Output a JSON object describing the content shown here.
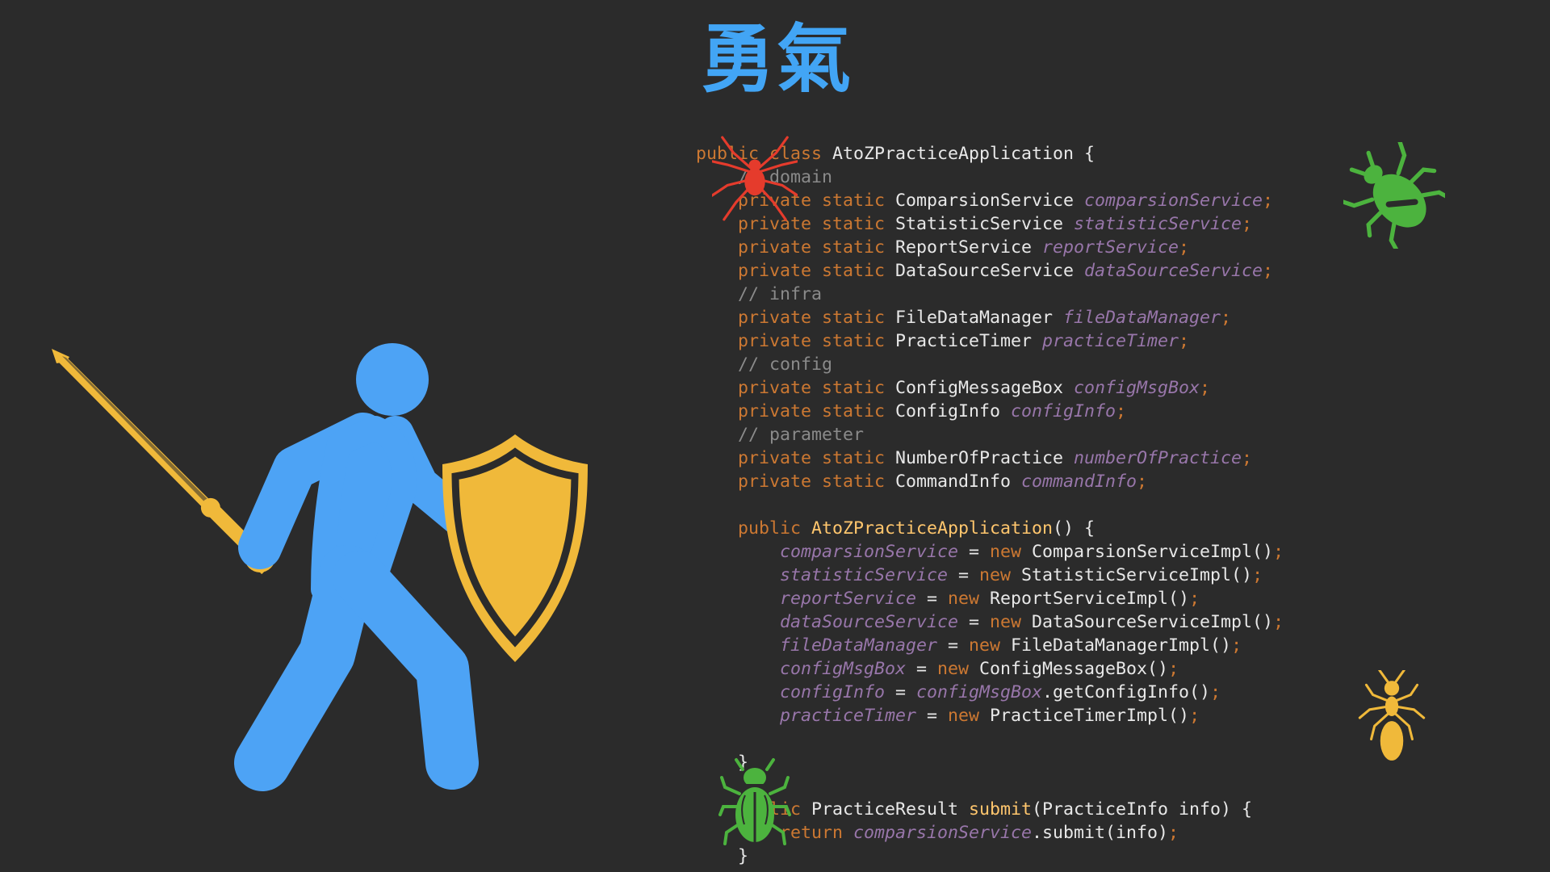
{
  "title": "勇氣",
  "icons": {
    "hero": "knight-with-sword-and-shield-icon",
    "bugs": [
      "spider-icon",
      "beetle-icon",
      "ant-icon",
      "scarab-beetle-icon"
    ]
  },
  "colors": {
    "background": "#2b2b2b",
    "title": "#42a5f5",
    "hero": "#4da3f5",
    "gold": "#f0b93a",
    "spider": "#e53b2c",
    "beetle": "#4cb33e",
    "ant": "#f0b93a"
  },
  "code_lines": [
    [
      {
        "t": "public ",
        "c": "kw"
      },
      {
        "t": "class ",
        "c": "kw"
      },
      {
        "t": "AtoZPracticeApplication ",
        "c": "cls"
      },
      {
        "t": "{",
        "c": "cls"
      }
    ],
    [
      {
        "t": "    // domain",
        "c": "cm"
      }
    ],
    [
      {
        "t": "    private static ",
        "c": "kw"
      },
      {
        "t": "ComparsionService ",
        "c": "cls"
      },
      {
        "t": "comparsionService",
        "c": "fld"
      },
      {
        "t": ";",
        "c": "punc"
      }
    ],
    [
      {
        "t": "    private static ",
        "c": "kw"
      },
      {
        "t": "StatisticService ",
        "c": "cls"
      },
      {
        "t": "statisticService",
        "c": "fld"
      },
      {
        "t": ";",
        "c": "punc"
      }
    ],
    [
      {
        "t": "    private static ",
        "c": "kw"
      },
      {
        "t": "ReportService ",
        "c": "cls"
      },
      {
        "t": "reportService",
        "c": "fld"
      },
      {
        "t": ";",
        "c": "punc"
      }
    ],
    [
      {
        "t": "    private static ",
        "c": "kw"
      },
      {
        "t": "DataSourceService ",
        "c": "cls"
      },
      {
        "t": "dataSourceService",
        "c": "fld"
      },
      {
        "t": ";",
        "c": "punc"
      }
    ],
    [
      {
        "t": "    // infra",
        "c": "cm"
      }
    ],
    [
      {
        "t": "    private static ",
        "c": "kw"
      },
      {
        "t": "FileDataManager ",
        "c": "cls"
      },
      {
        "t": "fileDataManager",
        "c": "fld"
      },
      {
        "t": ";",
        "c": "punc"
      }
    ],
    [
      {
        "t": "    private static ",
        "c": "kw"
      },
      {
        "t": "PracticeTimer ",
        "c": "cls"
      },
      {
        "t": "practiceTimer",
        "c": "fld"
      },
      {
        "t": ";",
        "c": "punc"
      }
    ],
    [
      {
        "t": "    // config",
        "c": "cm"
      }
    ],
    [
      {
        "t": "    private static ",
        "c": "kw"
      },
      {
        "t": "ConfigMessageBox ",
        "c": "cls"
      },
      {
        "t": "configMsgBox",
        "c": "fld"
      },
      {
        "t": ";",
        "c": "punc"
      }
    ],
    [
      {
        "t": "    private static ",
        "c": "kw"
      },
      {
        "t": "ConfigInfo ",
        "c": "cls"
      },
      {
        "t": "configInfo",
        "c": "fld"
      },
      {
        "t": ";",
        "c": "punc"
      }
    ],
    [
      {
        "t": "    // parameter",
        "c": "cm"
      }
    ],
    [
      {
        "t": "    private static ",
        "c": "kw"
      },
      {
        "t": "NumberOfPractice ",
        "c": "cls"
      },
      {
        "t": "numberOfPractice",
        "c": "fld"
      },
      {
        "t": ";",
        "c": "punc"
      }
    ],
    [
      {
        "t": "    private static ",
        "c": "kw"
      },
      {
        "t": "CommandInfo ",
        "c": "cls"
      },
      {
        "t": "commandInfo",
        "c": "fld"
      },
      {
        "t": ";",
        "c": "punc"
      }
    ],
    [],
    [
      {
        "t": "    public ",
        "c": "kw"
      },
      {
        "t": "AtoZPracticeApplication",
        "c": "fn"
      },
      {
        "t": "() {",
        "c": "cls"
      }
    ],
    [
      {
        "t": "        comparsionService",
        "c": "fld"
      },
      {
        "t": " = ",
        "c": "cls"
      },
      {
        "t": "new ",
        "c": "kw"
      },
      {
        "t": "ComparsionServiceImpl()",
        "c": "cls"
      },
      {
        "t": ";",
        "c": "punc"
      }
    ],
    [
      {
        "t": "        statisticService",
        "c": "fld"
      },
      {
        "t": " = ",
        "c": "cls"
      },
      {
        "t": "new ",
        "c": "kw"
      },
      {
        "t": "StatisticServiceImpl()",
        "c": "cls"
      },
      {
        "t": ";",
        "c": "punc"
      }
    ],
    [
      {
        "t": "        reportService",
        "c": "fld"
      },
      {
        "t": " = ",
        "c": "cls"
      },
      {
        "t": "new ",
        "c": "kw"
      },
      {
        "t": "ReportServiceImpl()",
        "c": "cls"
      },
      {
        "t": ";",
        "c": "punc"
      }
    ],
    [
      {
        "t": "        dataSourceService",
        "c": "fld"
      },
      {
        "t": " = ",
        "c": "cls"
      },
      {
        "t": "new ",
        "c": "kw"
      },
      {
        "t": "DataSourceServiceImpl()",
        "c": "cls"
      },
      {
        "t": ";",
        "c": "punc"
      }
    ],
    [
      {
        "t": "        fileDataManager",
        "c": "fld"
      },
      {
        "t": " = ",
        "c": "cls"
      },
      {
        "t": "new ",
        "c": "kw"
      },
      {
        "t": "FileDataManagerImpl()",
        "c": "cls"
      },
      {
        "t": ";",
        "c": "punc"
      }
    ],
    [
      {
        "t": "        configMsgBox",
        "c": "fld"
      },
      {
        "t": " = ",
        "c": "cls"
      },
      {
        "t": "new ",
        "c": "kw"
      },
      {
        "t": "ConfigMessageBox()",
        "c": "cls"
      },
      {
        "t": ";",
        "c": "punc"
      }
    ],
    [
      {
        "t": "        configInfo",
        "c": "fld"
      },
      {
        "t": " = ",
        "c": "cls"
      },
      {
        "t": "configMsgBox",
        "c": "fld"
      },
      {
        "t": ".getConfigInfo()",
        "c": "cls"
      },
      {
        "t": ";",
        "c": "punc"
      }
    ],
    [
      {
        "t": "        practiceTimer",
        "c": "fld"
      },
      {
        "t": " = ",
        "c": "cls"
      },
      {
        "t": "new ",
        "c": "kw"
      },
      {
        "t": "PracticeTimerImpl()",
        "c": "cls"
      },
      {
        "t": ";",
        "c": "punc"
      }
    ],
    [],
    [
      {
        "t": "    }",
        "c": "cls"
      }
    ],
    [],
    [
      {
        "t": "    public ",
        "c": "kw"
      },
      {
        "t": "PracticeResult ",
        "c": "cls"
      },
      {
        "t": "submit",
        "c": "fn"
      },
      {
        "t": "(PracticeInfo info) {",
        "c": "cls"
      }
    ],
    [
      {
        "t": "        return ",
        "c": "kw"
      },
      {
        "t": "comparsionService",
        "c": "fld"
      },
      {
        "t": ".submit(info)",
        "c": "cls"
      },
      {
        "t": ";",
        "c": "punc"
      }
    ],
    [
      {
        "t": "    }",
        "c": "cls"
      }
    ]
  ]
}
